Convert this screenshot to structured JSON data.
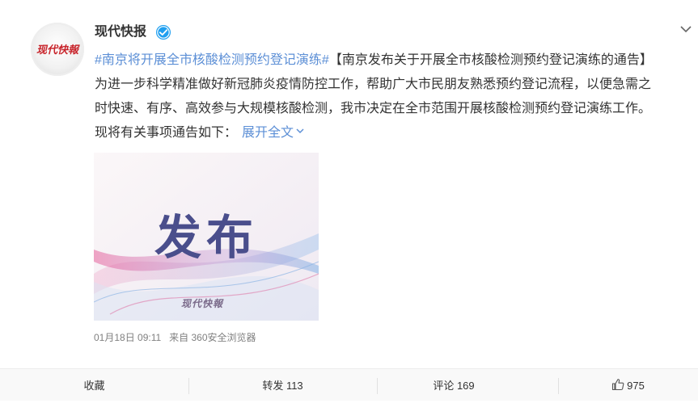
{
  "post": {
    "username": "现代快报",
    "avatar_text": "现代快報",
    "topic": "#南京将开展全市核酸检测预约登记演练#",
    "body": "【南京发布关于开展全市核酸检测预约登记演练的通告】为进一步科学精准做好新冠肺炎疫情防控工作，帮助广大市民朋友熟悉预约登记流程，以便急需之时快速、有序、高效参与大规模核酸检测，我市决定在全市范围开展核酸检测预约登记演练工作。现将有关事项通告如下：",
    "expand_label": "展开全文",
    "image_title": "发布",
    "image_watermark": "现代快報",
    "timestamp": "01月18日 09:11",
    "source": "来自 360安全浏览器",
    "verified_icon": "verified-badge-icon",
    "accent_color": "#5c8fd6"
  },
  "actions": {
    "favorite_label": "收藏",
    "repost_label": "转发 113",
    "comment_label": "评论 169",
    "like_count": "975"
  }
}
